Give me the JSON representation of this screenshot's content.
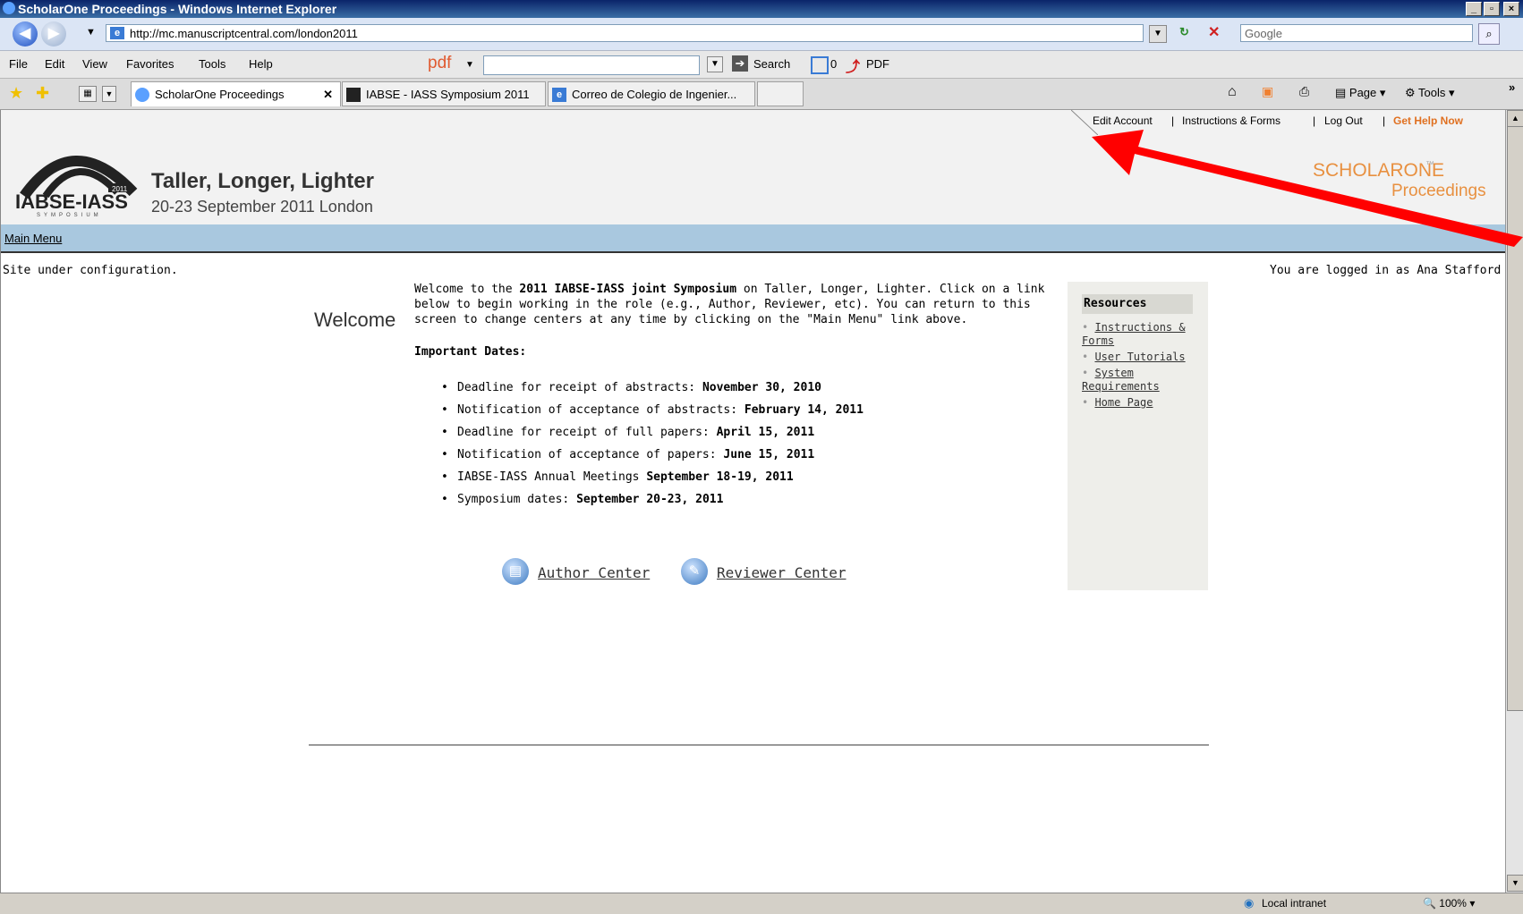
{
  "window": {
    "title": "ScholarOne Proceedings - Windows Internet Explorer"
  },
  "address": {
    "url": "http://mc.manuscriptcentral.com/london2011",
    "search_placeholder": "Google"
  },
  "menubar": {
    "items": [
      "File",
      "Edit",
      "View",
      "Favorites",
      "Tools",
      "Help"
    ],
    "pdf_label": "pdf",
    "search_label": "Search",
    "counter": "0",
    "pdf_button": "PDF"
  },
  "tabs": [
    {
      "label": "ScholarOne Proceedings"
    },
    {
      "label": "IABSE - IASS Symposium 2011"
    },
    {
      "label": "Correo de Colegio de Ingenier..."
    }
  ],
  "toolbar_right": {
    "page_label": "Page",
    "tools_label": "Tools"
  },
  "header": {
    "logo_year": "2011",
    "logo_text": "IABSE-IASS",
    "logo_sub": "SYMPOSIUM",
    "title": "Taller, Longer, Lighter",
    "subtitle": "20-23 September 2011 London",
    "links": [
      "Edit Account",
      "Instructions & Forms",
      "Log Out"
    ],
    "help": "Get Help Now",
    "brand_top": "SCHOLARONE",
    "brand_tm": "™",
    "brand_bottom": "Proceedings"
  },
  "nav": {
    "main_menu": "Main Menu"
  },
  "status": {
    "left": "Site under configuration.",
    "right": "You are logged in as Ana Stafford"
  },
  "welcome": {
    "heading": "Welcome",
    "intro_1": "Welcome to the ",
    "intro_bold": "2011 IABSE-IASS joint Symposium",
    "intro_2": " on Taller, Longer, Lighter. Click on a link below to begin working in the role (e.g., Author, Reviewer, etc). You can return to this screen to change centers at any time by clicking on the \"Main Menu\" link above.",
    "dates_title": "Important Dates:",
    "dates": [
      {
        "text": "Deadline for receipt of abstracts: ",
        "bold": "November 30, 2010"
      },
      {
        "text": "Notification of acceptance of abstracts: ",
        "bold": "February 14, 2011"
      },
      {
        "text": "Deadline for receipt of full papers: ",
        "bold": "April 15, 2011"
      },
      {
        "text": "Notification of acceptance of papers: ",
        "bold": "June 15, 2011"
      },
      {
        "text": "IABSE-IASS Annual Meetings ",
        "bold": "September 18-19, 2011"
      },
      {
        "text": "Symposium dates: ",
        "bold": "September 20-23, 2011"
      }
    ],
    "author_center": "Author Center",
    "reviewer_center": "Reviewer Center"
  },
  "resources": {
    "title": "Resources",
    "items": [
      "Instructions & Forms",
      "User Tutorials",
      "System Requirements",
      "Home Page"
    ]
  },
  "statusbar": {
    "zone": "Local intranet",
    "zoom": "100%"
  },
  "annotation": {
    "arrow_color": "#ff0000"
  }
}
